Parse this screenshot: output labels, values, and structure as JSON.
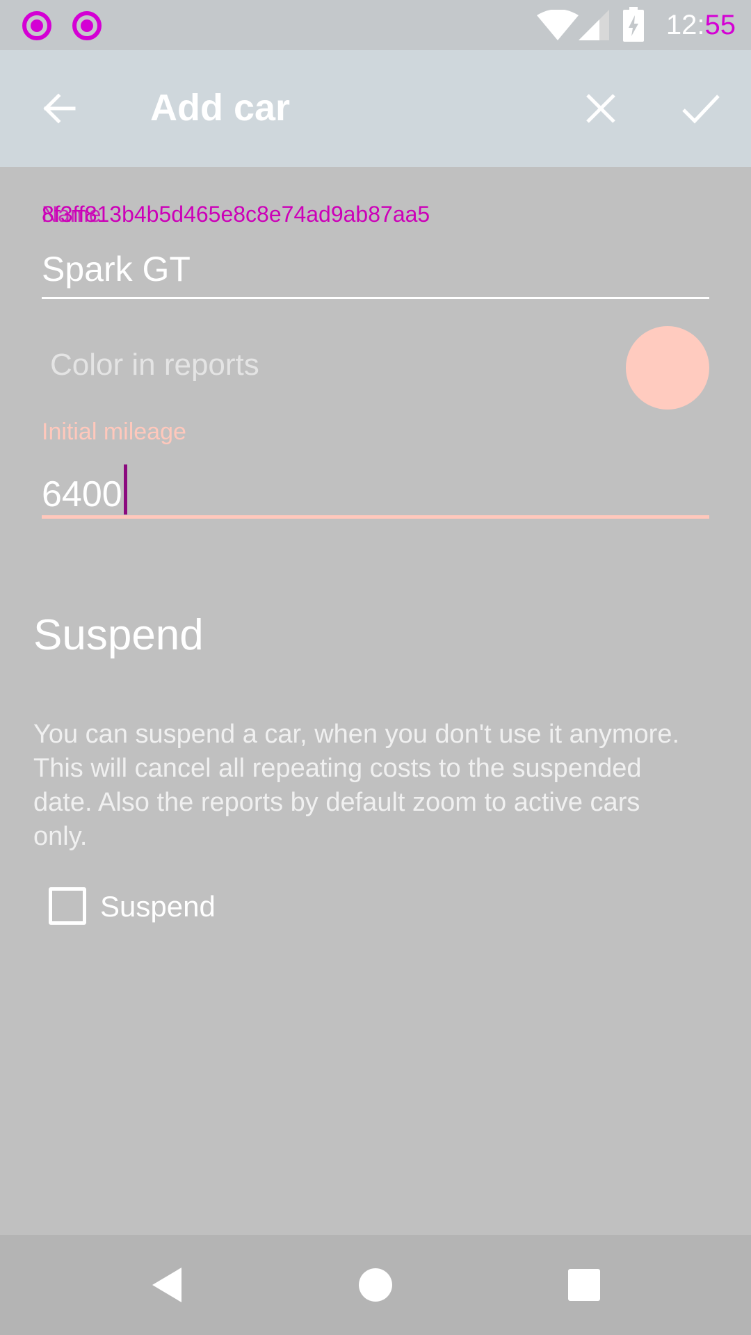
{
  "status_bar": {
    "notifications": [
      "notification-icon",
      "notification-icon"
    ],
    "clock": {
      "hours": "12:",
      "minutes": "55"
    }
  },
  "app_bar": {
    "title": "Add car",
    "back_icon": "arrow-left-icon",
    "cancel_icon": "close-icon",
    "save_icon": "check-icon"
  },
  "form": {
    "name": {
      "label": "Name",
      "debug_overlay": "8f3ff813b4b5d465e8c8e74ad9ab87aa5",
      "value": "Spark GT"
    },
    "color": {
      "label": "Color in reports",
      "swatch": "#ffcbbf"
    },
    "mileage": {
      "label": "Initial mileage",
      "value": "6400"
    }
  },
  "suspend": {
    "title": "Suspend",
    "description": "You can suspend a car, when you don't use it anymore. This will cancel all repeating costs to the suspended date. Also the reports by default zoom to active cars only.",
    "checkbox_label": "Suspend",
    "checked": false
  },
  "colors": {
    "accent": "#ffc8bc",
    "app_bar": "#cfd7dc",
    "background": "#c0c0c0",
    "debug_magenta": "#d400d4"
  }
}
